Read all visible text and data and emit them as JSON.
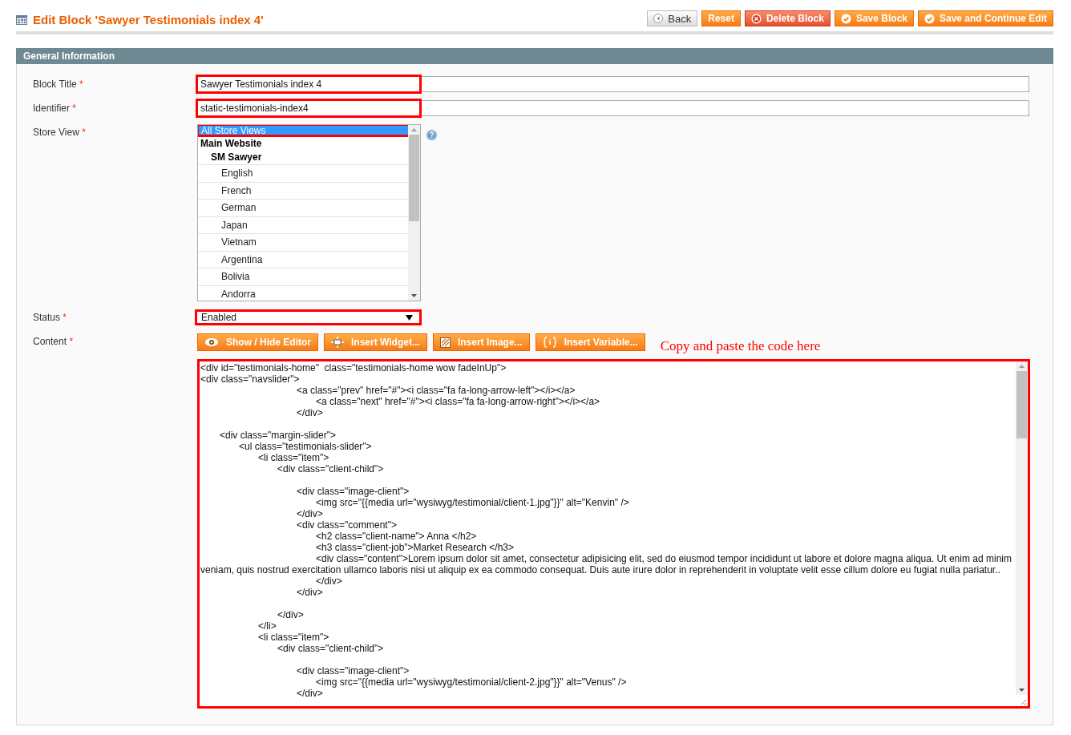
{
  "page": {
    "title": "Edit Block 'Sawyer Testimonials index 4'"
  },
  "actions": [
    {
      "label": "Back",
      "kind": "back"
    },
    {
      "label": "Reset",
      "kind": "plain"
    },
    {
      "label": "Delete Block",
      "kind": "delete"
    },
    {
      "label": "Save Block",
      "kind": "save"
    },
    {
      "label": "Save and Continue Edit",
      "kind": "save"
    }
  ],
  "section": {
    "title": "General Information"
  },
  "fields": [
    {
      "kind": "text",
      "label": "Block Title",
      "required_mark": "*",
      "value": "Sawyer Testimonials index 4",
      "highlighted": true
    },
    {
      "kind": "text",
      "label": "Identifier",
      "required_mark": "*",
      "value": "static-testimonials-index4",
      "highlighted": true
    },
    {
      "kind": "multiselect",
      "label": "Store View",
      "required_mark": "*",
      "highlighted": true,
      "options": [
        {
          "label": "All Store Views",
          "kind": "option",
          "selected": true
        },
        {
          "label": "Main Website",
          "kind": "group",
          "children": [
            {
              "label": "SM Sawyer",
              "kind": "group",
              "children": [
                {
                  "label": "English",
                  "kind": "option",
                  "selected": false
                },
                {
                  "label": "French",
                  "kind": "option",
                  "selected": false
                },
                {
                  "label": "German",
                  "kind": "option",
                  "selected": false
                },
                {
                  "label": "Japan",
                  "kind": "option",
                  "selected": false
                },
                {
                  "label": "Vietnam",
                  "kind": "option",
                  "selected": false
                },
                {
                  "label": "Argentina",
                  "kind": "option",
                  "selected": false
                },
                {
                  "label": "Bolivia",
                  "kind": "option",
                  "selected": false
                },
                {
                  "label": "Andorra",
                  "kind": "option",
                  "selected": false
                }
              ]
            }
          ]
        }
      ]
    },
    {
      "kind": "select",
      "label": "Status",
      "required_mark": "*",
      "value": "Enabled",
      "highlighted": true
    },
    {
      "kind": "editor",
      "label": "Content",
      "required_mark": "*",
      "highlighted": true,
      "annotation": "Copy and paste the code here",
      "toolbar": [
        {
          "label": "Show / Hide Editor",
          "kind": "eye"
        },
        {
          "label": "Insert Widget...",
          "kind": "widget"
        },
        {
          "label": "Insert Image...",
          "kind": "image"
        },
        {
          "label": "Insert Variable...",
          "kind": "variable"
        }
      ],
      "value": "<div id=\"testimonials-home\"  class=\"testimonials-home wow fadeInUp\">\n<div class=\"navslider\">\n\t\t\t\t\t<a class=\"prev\" href=\"#\"><i class=\"fa fa-long-arrow-left\"></i></a>\n\t\t\t\t\t\t<a class=\"next\" href=\"#\"><i class=\"fa fa-long-arrow-right\"></i></a>\n\t\t\t\t\t</div>\n\n\t<div class=\"margin-slider\">\n\t\t<ul class=\"testimonials-slider\">\n\t\t\t<li class=\"item\">\n\t\t\t\t<div class=\"client-child\">\n\n\t\t\t\t\t<div class=\"image-client\">\n\t\t\t\t\t\t<img src=\"{{media url=\"wysiwyg/testimonial/client-1.jpg\"}}\" alt=\"Kenvin\" />\n\t\t\t\t\t</div>\n\t\t\t\t\t<div class=\"comment\">\n\t\t\t\t\t\t<h2 class=\"client-name\"> Anna </h2>\n\t\t\t\t\t\t<h3 class=\"client-job\">Market Research </h3>\n\t\t\t\t\t\t<div class=\"content\">Lorem ipsum dolor sit amet, consectetur adipisicing elit, sed do eiusmod tempor incididunt ut labore et dolore magna aliqua. Ut enim ad minim veniam, quis nostrud exercitation ullamco laboris nisi ut aliquip ex ea commodo consequat. Duis aute irure dolor in reprehenderit in voluptate velit esse cillum dolore eu fugiat nulla pariatur..\n\t\t\t\t\t\t</div>\n\t\t\t\t\t</div>\n\n\t\t\t\t</div>\n\t\t\t</li>\n\t\t\t<li class=\"item\">\n\t\t\t\t<div class=\"client-child\">\n\n\t\t\t\t\t<div class=\"image-client\">\n\t\t\t\t\t\t<img src=\"{{media url=\"wysiwyg/testimonial/client-2.jpg\"}}\" alt=\"Venus\" />\n\t\t\t\t\t</div>"
    }
  ]
}
